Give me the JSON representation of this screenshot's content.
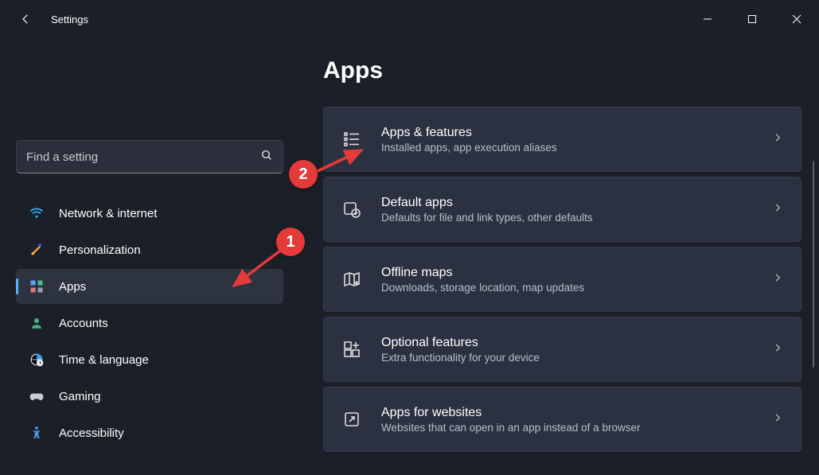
{
  "title": "Settings",
  "search": {
    "placeholder": "Find a setting"
  },
  "sidebar": {
    "items": [
      {
        "label": "Network & internet"
      },
      {
        "label": "Personalization"
      },
      {
        "label": "Apps"
      },
      {
        "label": "Accounts"
      },
      {
        "label": "Time & language"
      },
      {
        "label": "Gaming"
      },
      {
        "label": "Accessibility"
      }
    ],
    "selected_index": 2
  },
  "page": {
    "heading": "Apps",
    "cards": [
      {
        "title": "Apps & features",
        "desc": "Installed apps, app execution aliases"
      },
      {
        "title": "Default apps",
        "desc": "Defaults for file and link types, other defaults"
      },
      {
        "title": "Offline maps",
        "desc": "Downloads, storage location, map updates"
      },
      {
        "title": "Optional features",
        "desc": "Extra functionality for your device"
      },
      {
        "title": "Apps for websites",
        "desc": "Websites that can open in an app instead of a browser"
      }
    ]
  },
  "annotations": {
    "badge1": "1",
    "badge2": "2"
  }
}
